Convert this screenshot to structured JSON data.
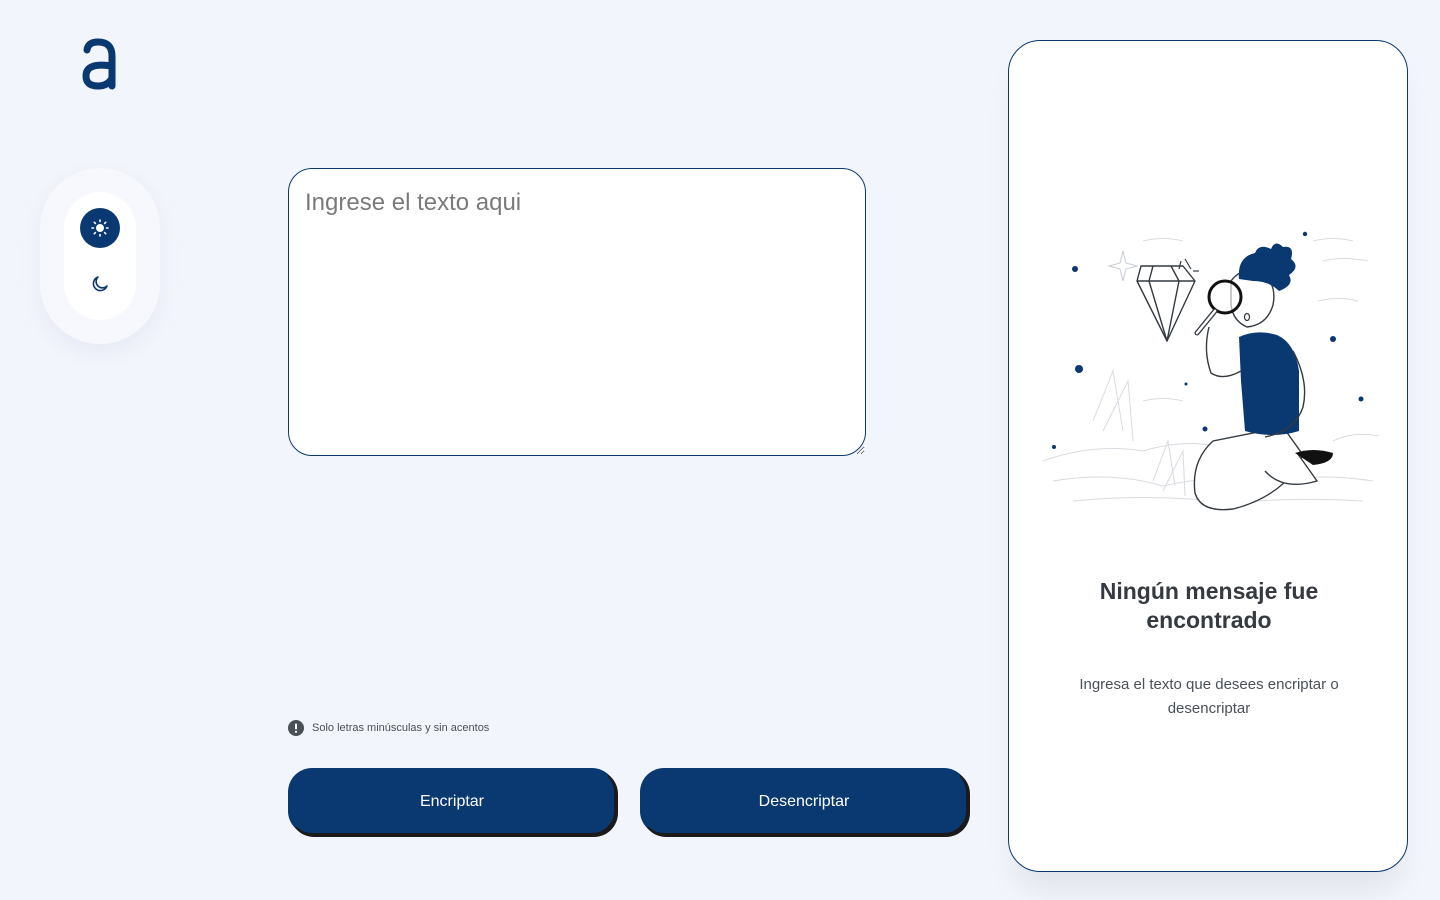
{
  "app": {
    "logo_letter": "a",
    "brand_color": "#0a3871",
    "background_color": "#f3f5fc"
  },
  "theme_toggle": {
    "options": [
      {
        "icon": "sun-icon",
        "selected": true
      },
      {
        "icon": "moon-icon",
        "selected": false
      }
    ]
  },
  "input": {
    "placeholder": "Ingrese el texto aqui",
    "value": ""
  },
  "hint": {
    "icon": "info-icon",
    "text": "Solo letras minúsculas y sin acentos"
  },
  "actions": {
    "encrypt_label": "Encriptar",
    "decrypt_label": "Desencriptar"
  },
  "output_panel": {
    "illustration": "person-magnifying-glass-diamond-illustration",
    "title": "Ningún mensaje fue encontrado",
    "subtitle": "Ingresa el texto que desees encriptar o desencriptar"
  }
}
